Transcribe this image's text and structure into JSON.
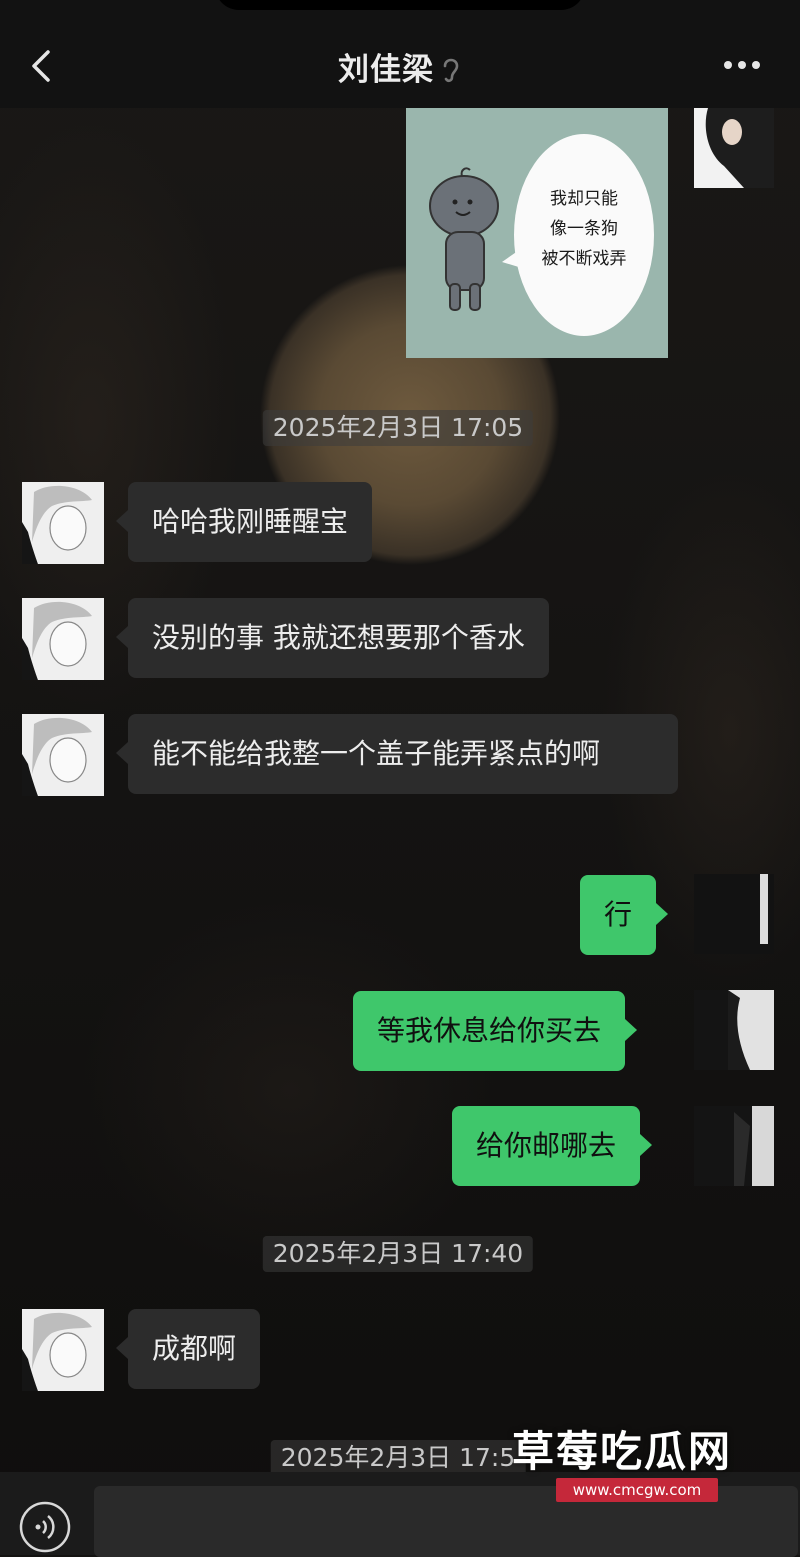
{
  "header": {
    "title": "刘佳梁",
    "back_icon": "chevron-left-icon",
    "more_icon": "more-dots-icon",
    "status_icon": "ear-icon"
  },
  "sticker": {
    "text": "我却只能\n像一条狗\n被不断戏弄"
  },
  "timestamps": [
    "2025年2月3日 17:05",
    "2025年2月3日 17:40",
    "2025年2月3日 17:5"
  ],
  "messages": [
    {
      "side": "incoming",
      "text": "哈哈我刚睡醒宝"
    },
    {
      "side": "incoming",
      "text": "没别的事 我就还想要那个香水"
    },
    {
      "side": "incoming",
      "text": "能不能给我整一个盖子能弄紧点的啊"
    },
    {
      "side": "outgoing",
      "text": "行"
    },
    {
      "side": "outgoing",
      "text": "等我休息给你买去"
    },
    {
      "side": "outgoing",
      "text": "给你邮哪去"
    },
    {
      "side": "incoming",
      "text": "成都啊"
    }
  ],
  "input": {
    "value": "",
    "voice_icon": "voice-icon"
  },
  "watermark": {
    "brand": "草莓吃瓜网",
    "url": "www.cmcgw.com"
  },
  "colors": {
    "incoming_bubble": "#2c2c2c",
    "outgoing_bubble": "#3fc76b",
    "background": "#141312"
  }
}
